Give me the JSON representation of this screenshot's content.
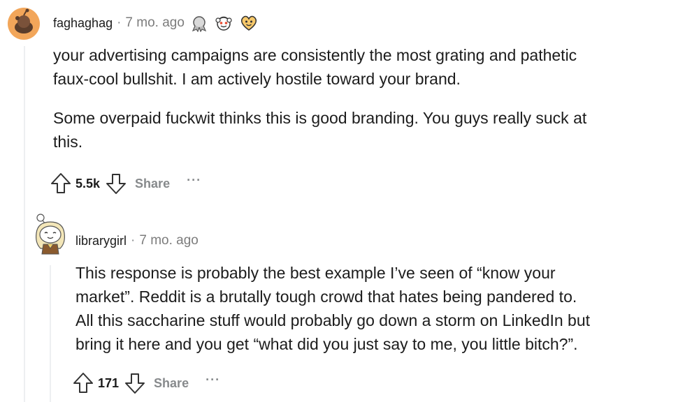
{
  "comments": [
    {
      "username": "faghaghag",
      "separator": "·",
      "time": "7 mo. ago",
      "awards": [
        "silver-award-icon",
        "wholesome-award-icon",
        "heart-award-icon"
      ],
      "paragraphs": [
        "your advertising campaigns are consistently the most grating and pathetic",
        "faux-cool bullshit. I am actively hostile toward your brand.",
        "Some overpaid fuckwit thinks this is good branding. You guys really suck at",
        "this."
      ],
      "score": "5.5k",
      "share_label": "Share",
      "more_label": "···"
    },
    {
      "username": "librarygirl",
      "separator": "·",
      "time": "7 mo. ago",
      "paragraphs": [
        "This response is probably the best example I’ve seen of “know your",
        "market”. Reddit is a brutally tough crowd that hates being pandered to.",
        "All this saccharine stuff would probably go down a storm on LinkedIn but",
        "bring it here and you get “what did you just say to me, you little bitch?”."
      ],
      "score": "171",
      "share_label": "Share",
      "more_label": "···"
    }
  ],
  "colors": {
    "avatar_orange": "#f2a65a",
    "muted": "#878a8c",
    "text": "#1c1c1c",
    "thread_line": "#edeff1"
  }
}
